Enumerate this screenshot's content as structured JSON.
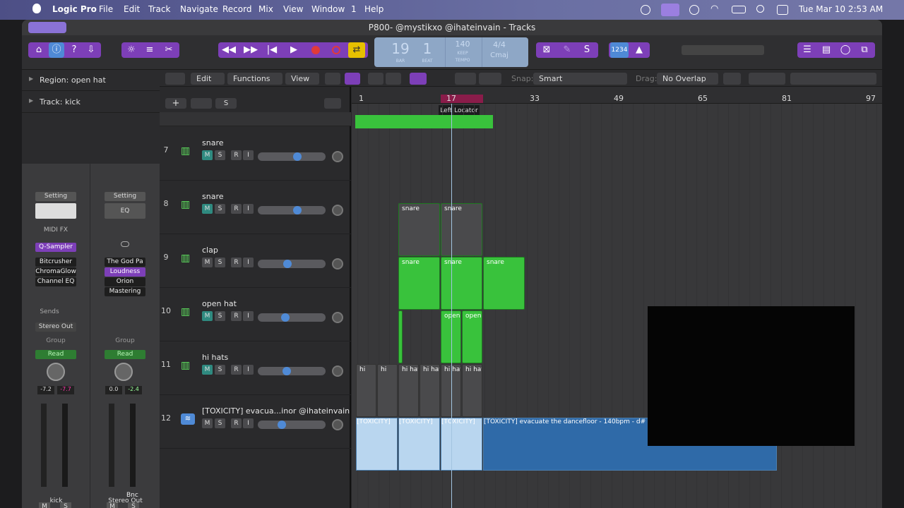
{
  "menubar": {
    "app": "Logic Pro",
    "items": [
      "File",
      "Edit",
      "Track",
      "Navigate",
      "Record",
      "Mix",
      "View",
      "Window",
      "1",
      "Help"
    ],
    "datetime": "Tue Mar 10  2:53 AM"
  },
  "window": {
    "title": "P800- @mystikxo @ihateinvain - Tracks"
  },
  "lcd": {
    "bar": "19",
    "beat": "1",
    "bar_label": "BAR",
    "beat_label": "BEAT",
    "tempo": "140",
    "keep": "KEEP",
    "tempo_label": "TEMPO",
    "sig": "4/4",
    "key": "Cmaj"
  },
  "toolbar": {
    "badge": "1234"
  },
  "inspector": {
    "region": "Region: open hat",
    "track": "Track: kick"
  },
  "strip1": {
    "setting": "Setting",
    "midifx": "MIDI FX",
    "instrument": "Q-Sampler",
    "plugins": [
      "Bitcrusher",
      "ChromaGlow",
      "Channel EQ"
    ],
    "sends": "Sends",
    "output": "Stereo Out",
    "group": "Group",
    "read": "Read",
    "pan1": "-7.2",
    "pan2": "-7.7",
    "m": "M",
    "s": "S",
    "name": "kick"
  },
  "strip2": {
    "setting": "Setting",
    "eq": "EQ",
    "plugins": [
      "The God Pa",
      "Loudness",
      "Orion",
      "Mastering"
    ],
    "group": "Group",
    "read": "Read",
    "pan1": "0.0",
    "pan2": "-2.4",
    "bnc": "Bnc",
    "m": "M",
    "s": "S",
    "name": "Stereo Out"
  },
  "edit_bar": {
    "edit": "Edit",
    "functions": "Functions",
    "view": "View",
    "snap_label": "Snap:",
    "snap": "Smart",
    "drag_label": "Drag:",
    "drag": "No Overlap"
  },
  "ruler": {
    "marks": [
      "1",
      "17",
      "33",
      "49",
      "65",
      "81",
      "97"
    ],
    "tooltip": "Left Locator"
  },
  "tracks": [
    {
      "num": "7",
      "name": "snare"
    },
    {
      "num": "8",
      "name": "snare"
    },
    {
      "num": "9",
      "name": "clap"
    },
    {
      "num": "10",
      "name": "open hat"
    },
    {
      "num": "11",
      "name": "hi hats"
    },
    {
      "num": "12",
      "name": "[TOXICITY] evacua...inor  @ihateinvain"
    }
  ],
  "msr": {
    "m": "M",
    "s": "S",
    "r": "R",
    "i": "I"
  },
  "regions": {
    "snare": "snare",
    "open": "open",
    "hi": "hi",
    "hihat": "hi hat",
    "tox": "[TOXICITY]",
    "tox_long": "[TOXICITY] evacuate the dancefloor - 140bpm - d# m"
  },
  "colors": {
    "region_green": "#39c23c",
    "audio_blue": "#b9d6ef",
    "accent_purple": "#7d3fb8"
  }
}
